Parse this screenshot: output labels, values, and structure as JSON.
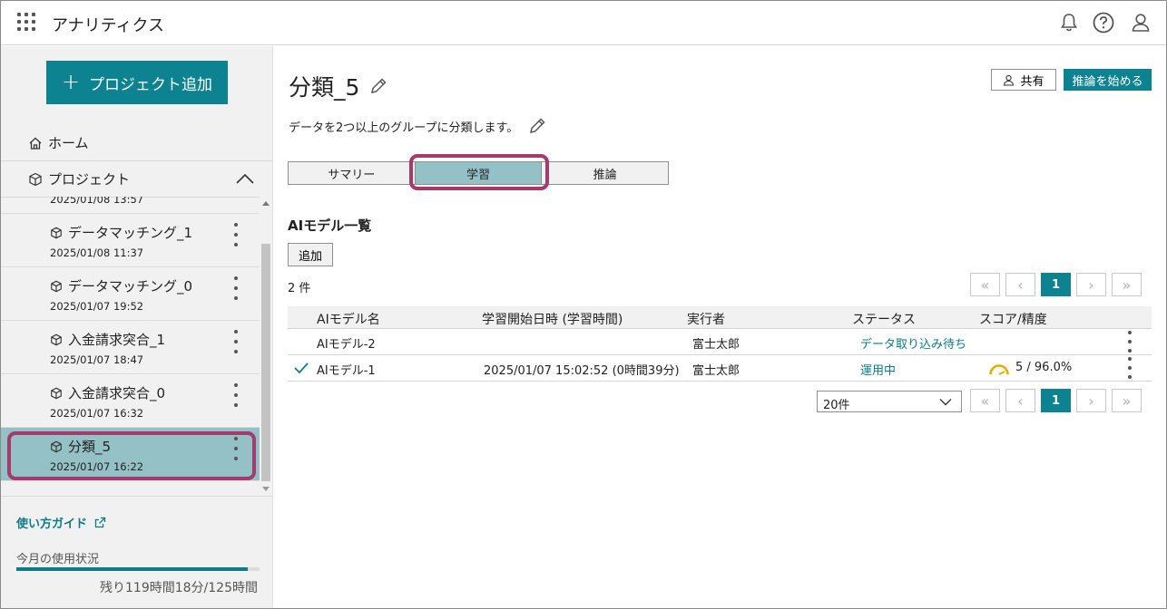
{
  "header": {
    "title": "アナリティクス",
    "icons": [
      "apps-grid-icon",
      "bell-icon",
      "help-icon",
      "user-icon"
    ]
  },
  "sidebar": {
    "add_project_label": "プロジェクト追加",
    "home_label": "ホーム",
    "projects_label": "プロジェクト",
    "partial_item_date": "2025/01/08 13:57",
    "projects": [
      {
        "name": "データマッチング_1",
        "date": "2025/01/08 11:37",
        "selected": false
      },
      {
        "name": "データマッチング_0",
        "date": "2025/01/07 19:52",
        "selected": false
      },
      {
        "name": "入金請求突合_1",
        "date": "2025/01/07 18:47",
        "selected": false
      },
      {
        "name": "入金請求突合_0",
        "date": "2025/01/07 16:32",
        "selected": false
      },
      {
        "name": "分類_5",
        "date": "2025/01/07 16:22",
        "selected": true
      }
    ],
    "guide_label": "使い方ガイド",
    "usage_label": "今月の使用状況",
    "usage_fraction": 0.95,
    "usage_remaining": "残り119時間18分/125時間"
  },
  "main": {
    "title": "分類_5",
    "share_label": "共有",
    "start_inference_label": "推論を始める",
    "description": "データを2つ以上のグループに分類します。",
    "tabs": [
      {
        "label": "サマリー",
        "active": false
      },
      {
        "label": "学習",
        "active": true
      },
      {
        "label": "推論",
        "active": false
      }
    ],
    "section_title": "AIモデル一覧",
    "add_label": "追加",
    "count_label": "2 件",
    "pager": {
      "first": "«",
      "prev": "‹",
      "current": "1",
      "next": "›",
      "last": "»"
    },
    "columns": [
      "AIモデル名",
      "学習開始日時 (学習時間)",
      "実行者",
      "ステータス",
      "スコア/精度"
    ],
    "rows": [
      {
        "name": "AIモデル-2",
        "started": "",
        "runner": "富士太郎",
        "status": "データ取り込み待ち",
        "score": "",
        "checked": false
      },
      {
        "name": "AIモデル-1",
        "started": "2025/01/07 15:02:52 (0時間39分)",
        "runner": "富士太郎",
        "status": "運用中",
        "score": "5 / 96.0%",
        "checked": true
      }
    ],
    "page_size": "20件"
  },
  "colors": {
    "accent": "#0d8290",
    "selection": "#93c1c6",
    "highlight": "#a43b6e",
    "gauge": "#e0b000"
  }
}
